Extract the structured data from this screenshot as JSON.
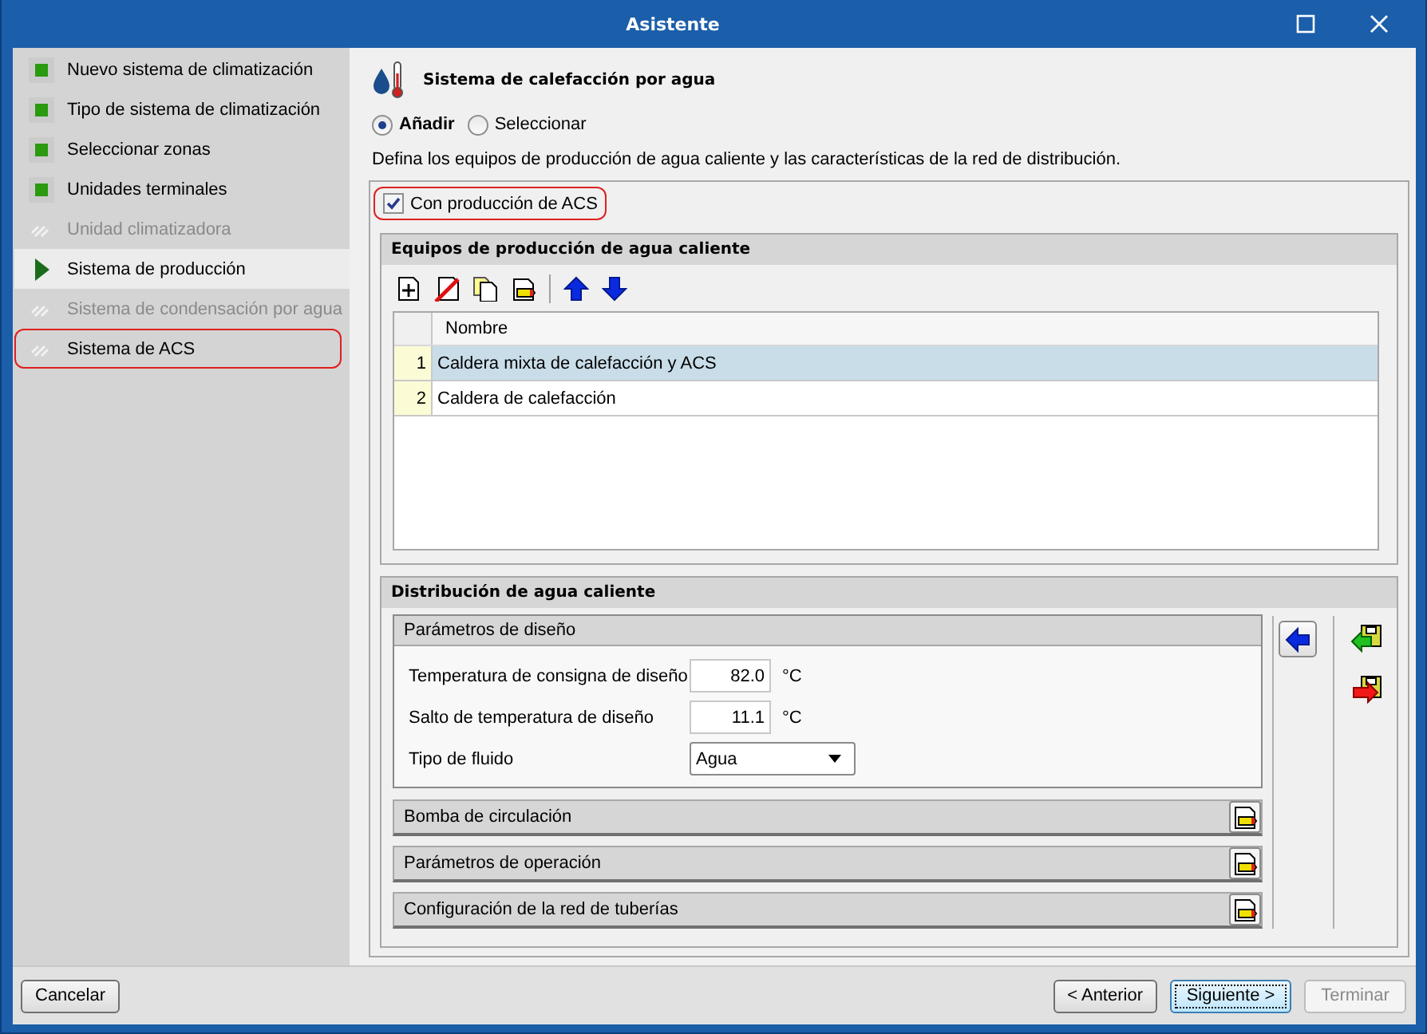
{
  "window": {
    "title": "Asistente"
  },
  "steps": [
    {
      "label": "Nuevo sistema de climatización",
      "kind": "done",
      "disabled": false,
      "highlighted": false
    },
    {
      "label": "Tipo de sistema de climatización",
      "kind": "done",
      "disabled": false,
      "highlighted": false
    },
    {
      "label": "Seleccionar zonas",
      "kind": "done",
      "disabled": false,
      "highlighted": false
    },
    {
      "label": "Unidades terminales",
      "kind": "done",
      "disabled": false,
      "highlighted": false
    },
    {
      "label": "Unidad climatizadora",
      "kind": "todo",
      "disabled": true,
      "highlighted": false
    },
    {
      "label": "Sistema de producción",
      "kind": "current",
      "disabled": false,
      "highlighted": false
    },
    {
      "label": "Sistema de condensación por agua",
      "kind": "todo",
      "disabled": true,
      "highlighted": false
    },
    {
      "label": "Sistema de ACS",
      "kind": "todo",
      "disabled": false,
      "highlighted": true
    }
  ],
  "header": {
    "title": "Sistema de calefacción por agua"
  },
  "mode_options": [
    {
      "label": "Añadir",
      "selected": true
    },
    {
      "label": "Seleccionar",
      "selected": false
    }
  ],
  "description": "Defina los equipos de producción de agua caliente y las características de la red de distribución.",
  "acs_checkbox": {
    "label": "Con producción de ACS",
    "checked": true,
    "highlighted": true
  },
  "equipment": {
    "title": "Equipos de producción de agua caliente",
    "columns": [
      "Nombre"
    ],
    "rows": [
      {
        "index": "1",
        "name": "Caldera mixta de calefacción y ACS",
        "selected": true
      },
      {
        "index": "2",
        "name": "Caldera de calefacción",
        "selected": false
      }
    ]
  },
  "distribution": {
    "title": "Distribución de agua caliente",
    "design": {
      "title": "Parámetros de diseño",
      "fields": [
        {
          "kind": "number",
          "label": "Temperatura de consigna de diseño",
          "value": "82.0",
          "unit": "°C"
        },
        {
          "kind": "number",
          "label": "Salto de temperatura de diseño",
          "value": "11.1",
          "unit": "°C"
        },
        {
          "kind": "select",
          "label": "Tipo de fluido",
          "value": "Agua"
        }
      ]
    },
    "sections": [
      {
        "title": "Bomba de circulación"
      },
      {
        "title": "Parámetros de operación"
      },
      {
        "title": "Configuración de la red de tuberías"
      }
    ]
  },
  "footer": {
    "left_buttons": [
      {
        "label": "Cancelar",
        "default": false,
        "disabled": false
      }
    ],
    "right_buttons": [
      {
        "label": "< Anterior",
        "default": false,
        "disabled": false
      },
      {
        "label": "Siguiente >",
        "default": true,
        "disabled": false
      },
      {
        "label": "Terminar",
        "default": false,
        "disabled": true
      }
    ]
  }
}
